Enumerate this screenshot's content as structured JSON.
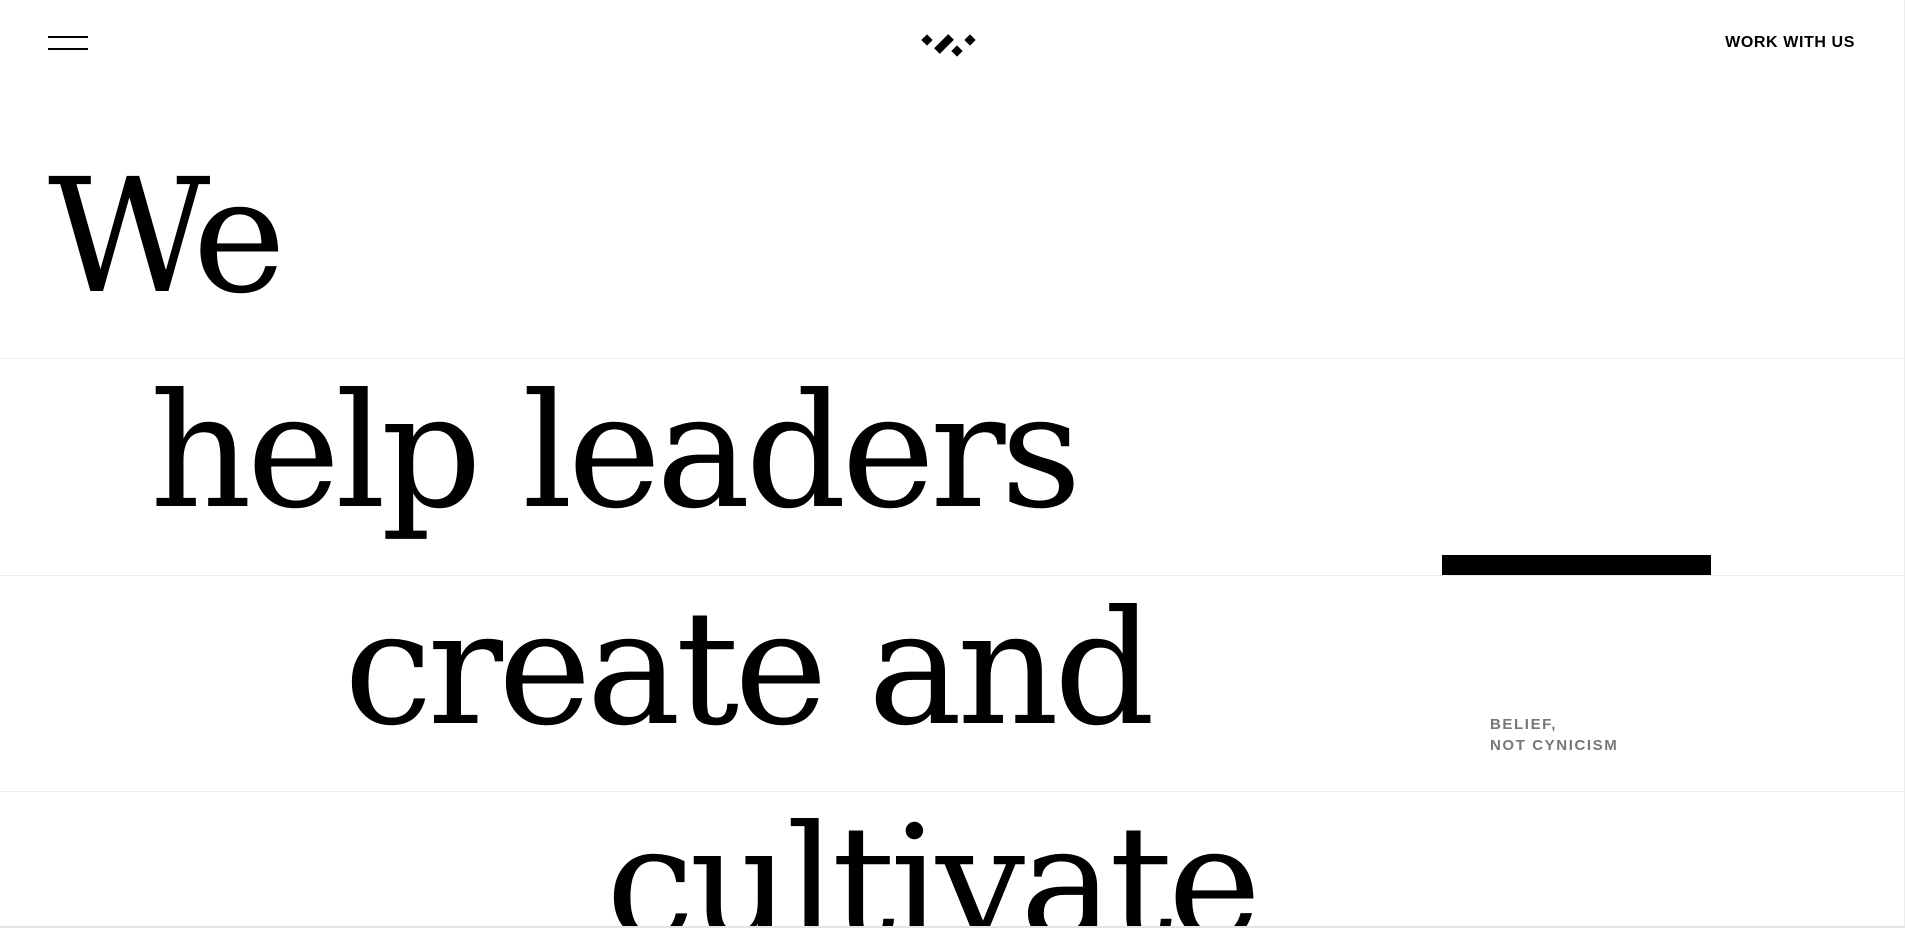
{
  "header": {
    "menu_icon": "hamburger-menu-icon",
    "logo_icon": "brand-logo-icon",
    "cta_label": "WORK WITH US"
  },
  "hero": {
    "lines": [
      "We",
      "help leaders",
      "create and",
      "cultivate"
    ]
  },
  "tagline": {
    "line1": "BELIEF,",
    "line2": "NOT CYNICISM"
  },
  "colors": {
    "text": "#000000",
    "background": "#ffffff",
    "muted": "#777777",
    "divider": "#ececec"
  }
}
